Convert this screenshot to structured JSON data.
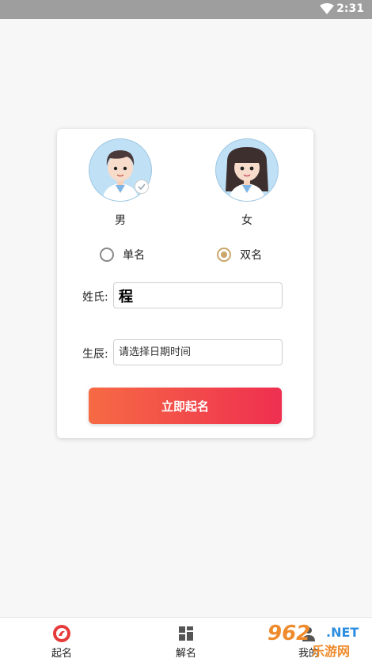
{
  "status_bar": {
    "time": "2:31"
  },
  "gender": {
    "male_label": "男",
    "female_label": "女",
    "selected": "male"
  },
  "name_type": {
    "single_label": "单名",
    "double_label": "双名",
    "selected": "double"
  },
  "form": {
    "surname_label": "姓氏:",
    "surname_value": "程",
    "birth_label": "生辰:",
    "birth_placeholder": "请选择日期时间",
    "submit_label": "立即起名"
  },
  "tabs": [
    {
      "label": "起名",
      "icon": "logo-icon",
      "active": true
    },
    {
      "label": "解名",
      "icon": "grid-icon",
      "active": false
    },
    {
      "label": "我的",
      "icon": "user-icon",
      "active": false
    }
  ],
  "watermark": {
    "number": "962",
    "net": ".NET",
    "text": "乐游网"
  },
  "colors": {
    "accent_start": "#f66a44",
    "accent_end": "#ef2f50",
    "radio_checked": "#c9a76a",
    "avatar_bg": "#bfe0f5"
  }
}
